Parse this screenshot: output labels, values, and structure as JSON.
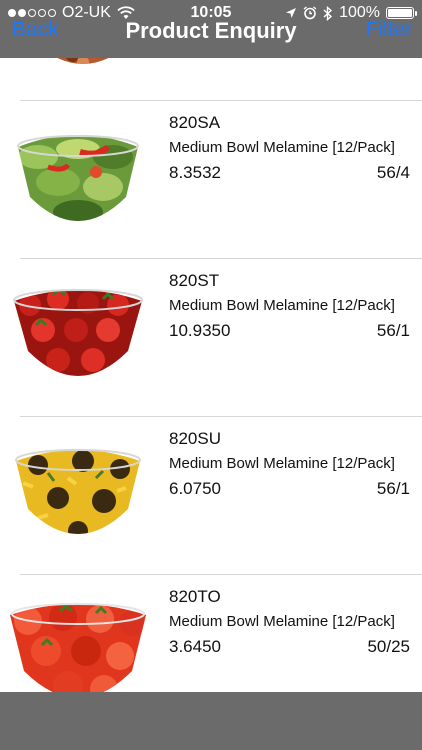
{
  "status_bar": {
    "carrier": "O2-UK",
    "time": "10:05",
    "battery": "100%"
  },
  "nav": {
    "back_label": "Back",
    "title": "Product Enquiry",
    "filter_label": "Filter"
  },
  "products": [
    {
      "code": "820SA",
      "description": "Medium Bowl Melamine [12/Pack]",
      "price": "8.3532",
      "stock": "56/4",
      "pattern": "salad"
    },
    {
      "code": "820ST",
      "description": "Medium Bowl Melamine [12/Pack]",
      "price": "10.9350",
      "stock": "56/1",
      "pattern": "strawberry"
    },
    {
      "code": "820SU",
      "description": "Medium Bowl Melamine [12/Pack]",
      "price": "6.0750",
      "stock": "56/1",
      "pattern": "sunflower"
    },
    {
      "code": "820TO",
      "description": "Medium Bowl Melamine [12/Pack]",
      "price": "3.6450",
      "stock": "50/25",
      "pattern": "tomato"
    }
  ]
}
